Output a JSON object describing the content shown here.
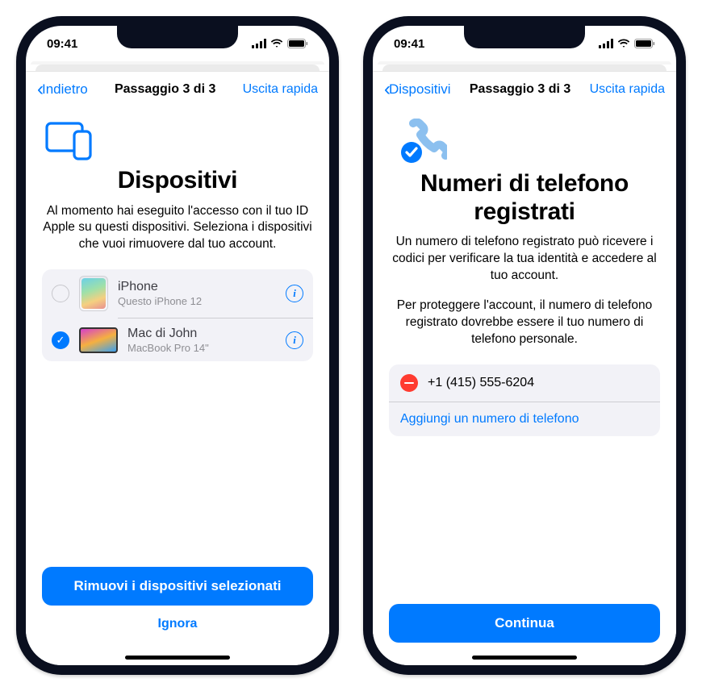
{
  "status": {
    "time": "09:41"
  },
  "left": {
    "nav": {
      "back": "Indietro",
      "step": "Passaggio 3 di 3",
      "exit": "Uscita rapida"
    },
    "title": "Dispositivi",
    "subtitle": "Al momento hai eseguito l'accesso con il tuo ID Apple su questi dispositivi. Seleziona i dispositivi che vuoi rimuovere dal tuo account.",
    "devices": [
      {
        "name": "iPhone",
        "sub": "Questo iPhone 12",
        "checked": false,
        "type": "iphone"
      },
      {
        "name": "Mac di John",
        "sub": "MacBook Pro 14\"",
        "checked": true,
        "type": "mac"
      }
    ],
    "primary": "Rimuovi i dispositivi selezionati",
    "secondary": "Ignora"
  },
  "right": {
    "nav": {
      "back": "Dispositivi",
      "step": "Passaggio 3 di 3",
      "exit": "Uscita rapida"
    },
    "title": "Numeri di telefono registrati",
    "subtitle": "Un numero di telefono registrato può ricevere i codici per verificare la tua identità e accedere al tuo account.",
    "subtitle2": "Per proteggere l'account, il numero di telefono registrato dovrebbe essere il tuo numero di telefono personale.",
    "phone": "+1 (415) 555-6204",
    "add": "Aggiungi un numero di telefono",
    "primary": "Continua"
  }
}
